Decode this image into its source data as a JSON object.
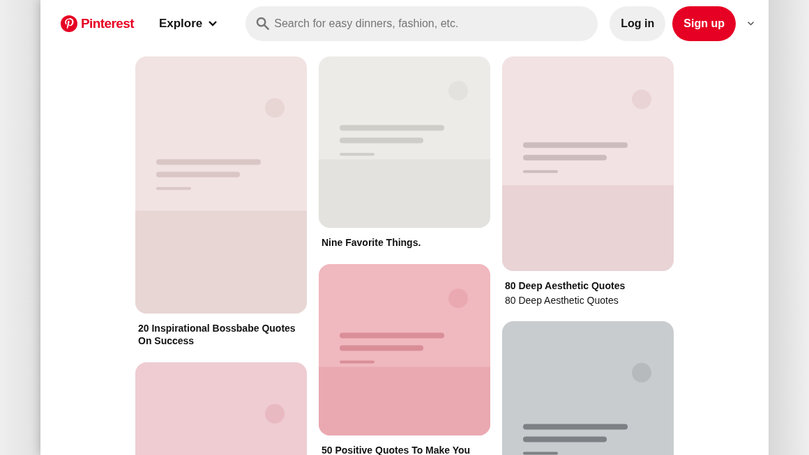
{
  "header": {
    "logo": "Pinterest",
    "explore": "Explore",
    "search": {
      "placeholder": "Search for easy dinners, fashion, etc."
    },
    "login": "Log in",
    "signup": "Sign up"
  },
  "columns": [
    {
      "pins": [
        {
          "kind": "tall",
          "title": "20 Inspirational Bossbabe Quotes On Success"
        },
        {
          "kind": "tall"
        }
      ]
    },
    {
      "pins": [
        {
          "kind": "square",
          "title": "Nine Favorite Things."
        },
        {
          "kind": "square",
          "title": "50 Positive Quotes To Make You"
        }
      ]
    },
    {
      "pins": [
        {
          "kind": "portrait",
          "title": "80 Deep Aesthetic Quotes",
          "subtitle": "80 Deep Aesthetic Quotes"
        },
        {
          "kind": "tall"
        }
      ]
    }
  ]
}
